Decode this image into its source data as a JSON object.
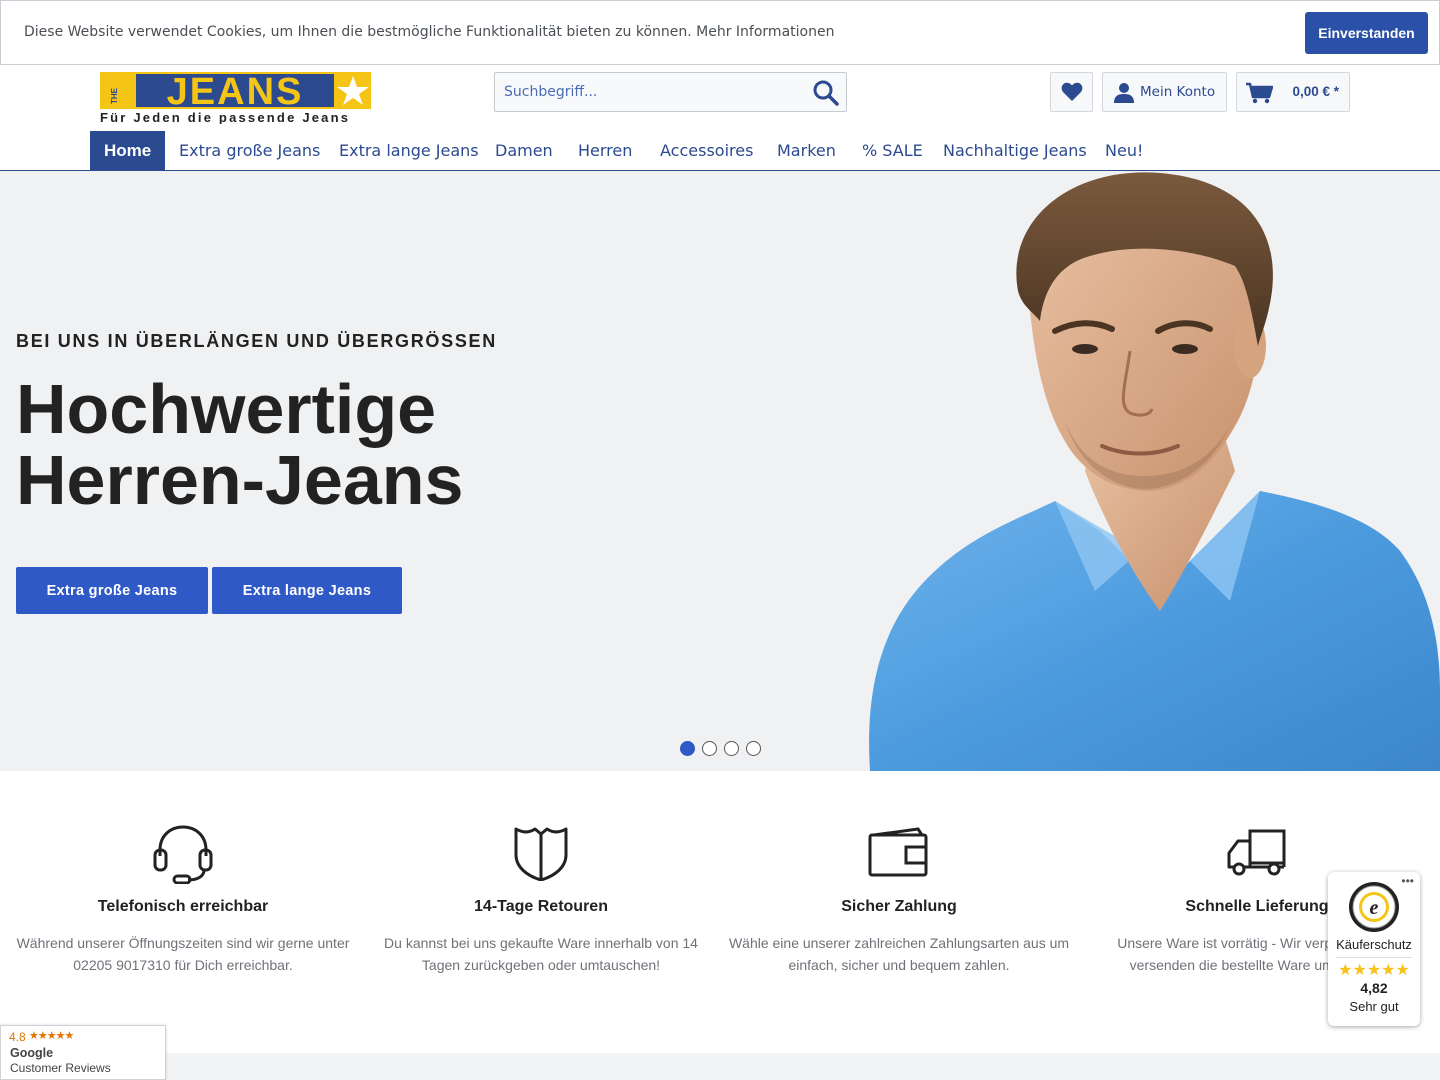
{
  "cookie": {
    "text": "Diese Website verwendet Cookies, um Ihnen die bestmögliche Funktionalität bieten zu können. Mehr Informationen",
    "accept_label": "Einverstanden"
  },
  "header": {
    "logo_word": "JEANS",
    "logo_the": "THE",
    "logo_tagline": "Für Jeden die passende Jeans",
    "search_placeholder": "Suchbegriff...",
    "account_label": "Mein Konto",
    "cart_total": "0,00 € *"
  },
  "nav": {
    "items": [
      {
        "label": "Home"
      },
      {
        "label": "Extra große Jeans"
      },
      {
        "label": "Extra lange Jeans"
      },
      {
        "label": "Damen"
      },
      {
        "label": "Herren"
      },
      {
        "label": "Accessoires"
      },
      {
        "label": "Marken"
      },
      {
        "label": "% SALE"
      },
      {
        "label": "Nachhaltige Jeans"
      },
      {
        "label": "Neu!"
      }
    ]
  },
  "hero": {
    "kicker": "BEI UNS IN ÜBERLÄNGEN UND ÜBERGRÖSSEN",
    "title_line1": "Hochwertige",
    "title_line2": "Herren-Jeans",
    "buttons": [
      {
        "label": "Extra große Jeans"
      },
      {
        "label": "Extra lange Jeans"
      }
    ],
    "slides_count": 4,
    "active_slide": 1
  },
  "features": [
    {
      "icon": "headset-icon",
      "title": "Telefonisch erreichbar",
      "text": "Während unserer Öffnungszeiten sind wir gerne unter 02205 9017310 für Dich erreichbar."
    },
    {
      "icon": "shield-icon",
      "title": "14-Tage Retouren",
      "text": "Du kannst bei uns gekaufte Ware innerhalb von 14 Tagen zurückgeben oder umtauschen!"
    },
    {
      "icon": "wallet-icon",
      "title": "Sicher Zahlung",
      "text": "Wähle eine unserer zahlreichen Zahlungsarten aus um einfach, sicher und bequem zahlen."
    },
    {
      "icon": "truck-icon",
      "title": "Schnelle Lieferung",
      "text": "Unsere Ware ist vorrätig - Wir verpacken und versenden die bestellte Ware umgehend."
    }
  ],
  "trusted_shops": {
    "label": "Käuferschutz",
    "stars": "★★★★★",
    "score": "4,82",
    "grade": "Sehr gut"
  },
  "google_reviews": {
    "rating": "4.8",
    "stars": "★★★★★",
    "brand": "Google",
    "caption": "Customer Reviews"
  },
  "colors": {
    "brand_blue": "#2b4a8f",
    "button_blue": "#2f59c7",
    "logo_yellow": "#f5c516"
  }
}
